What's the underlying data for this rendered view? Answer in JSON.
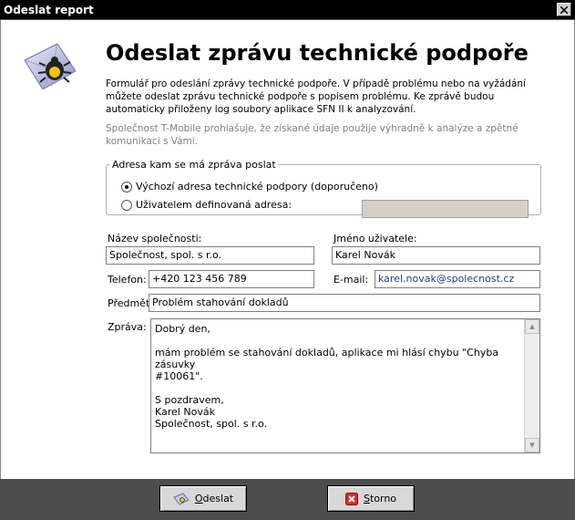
{
  "window": {
    "title": "Odeslat report"
  },
  "header": {
    "heading": "Odeslat zprávu technické podpoře"
  },
  "intro": "Formulář pro odeslání zprávy technické podpoře. V případě problému nebo na vyžádání můžete odeslat zprávu technické podpoře s popisem problému. Ke zprávě budou automaticky přiloženy log soubory aplikace SFN II k analyzování.",
  "disclaimer": "Společnost T-Mobile prohlašuje, že získané údaje použije výhradně k analýze a zpětné komunikaci s Vámi.",
  "address": {
    "legend": "Adresa kam se má zpráva poslat",
    "option_default": "Výchozí adresa technické podpory (doporučeno)",
    "option_custom": "Uživatelem definovaná adresa:",
    "selected": "default",
    "custom_value": ""
  },
  "form": {
    "company_label": "Název společnosti:",
    "company_value": "Společnost, spol. s r.o.",
    "user_label": "Jméno uživatele:",
    "user_value": "Karel Novák",
    "phone_label": "Telefon:",
    "phone_value": "+420 123 456 789",
    "email_label": "E-mail:",
    "email_value": "karel.novak@spolecnost.cz",
    "subject_label": "Předmět:",
    "subject_value": "Problém stahování dokladů",
    "message_label": "Zpráva:",
    "message_value": "Dobrý den,\n\nmám problém se stahování dokladů, aplikace mi hlásí chybu \"Chyba zásuvky\n#10061\".\n\nS pozdravem,\nKarel Novák\nSpolečnost, spol. s r.o."
  },
  "buttons": {
    "send_underlined": "O",
    "send_rest": "deslat",
    "cancel_underlined": "S",
    "cancel_rest": "torno"
  },
  "colors": {
    "titlebar": "#000000",
    "footer": "#4d4d4d",
    "email_text": "#1f3c8f"
  }
}
